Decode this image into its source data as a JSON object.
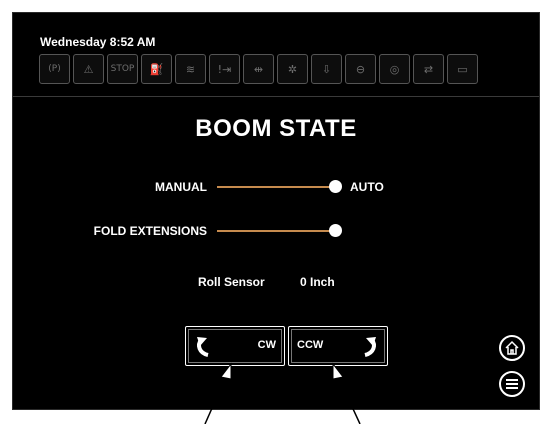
{
  "header": {
    "datetime": "Wednesday 8:52 AM",
    "icons": [
      {
        "name": "parking-brake-icon",
        "glyph": "(P)"
      },
      {
        "name": "warning-icon",
        "glyph": "⚠"
      },
      {
        "name": "stop-icon",
        "glyph": "STOP"
      },
      {
        "name": "tank-icon",
        "glyph": "⛽"
      },
      {
        "name": "fluid-level-icon",
        "glyph": "≋"
      },
      {
        "name": "boom-alert-icon",
        "glyph": "!⇥"
      },
      {
        "name": "boom-fold-icon",
        "glyph": "⇹"
      },
      {
        "name": "spray-icon",
        "glyph": "✲"
      },
      {
        "name": "height-icon",
        "glyph": "⇩"
      },
      {
        "name": "pump-icon",
        "glyph": "⊖"
      },
      {
        "name": "pressure-icon",
        "glyph": "◎"
      },
      {
        "name": "valve-icon",
        "glyph": "⇄"
      },
      {
        "name": "display-icon",
        "glyph": "▭"
      }
    ]
  },
  "main": {
    "title": "BOOM STATE",
    "mode_toggle": {
      "left_label": "MANUAL",
      "right_label": "AUTO",
      "state": "AUTO"
    },
    "fold_toggle": {
      "label": "FOLD EXTENSIONS"
    },
    "roll_sensor": {
      "label": "Roll Sensor",
      "value": "0 Inch"
    },
    "buttons": {
      "cw_label": "CW",
      "ccw_label": "CCW"
    }
  },
  "colors": {
    "accent": "#c68b4e",
    "background": "#000000",
    "text": "#ffffff"
  },
  "nav": {
    "home_icon": "home-icon",
    "menu_icon": "menu-icon"
  }
}
